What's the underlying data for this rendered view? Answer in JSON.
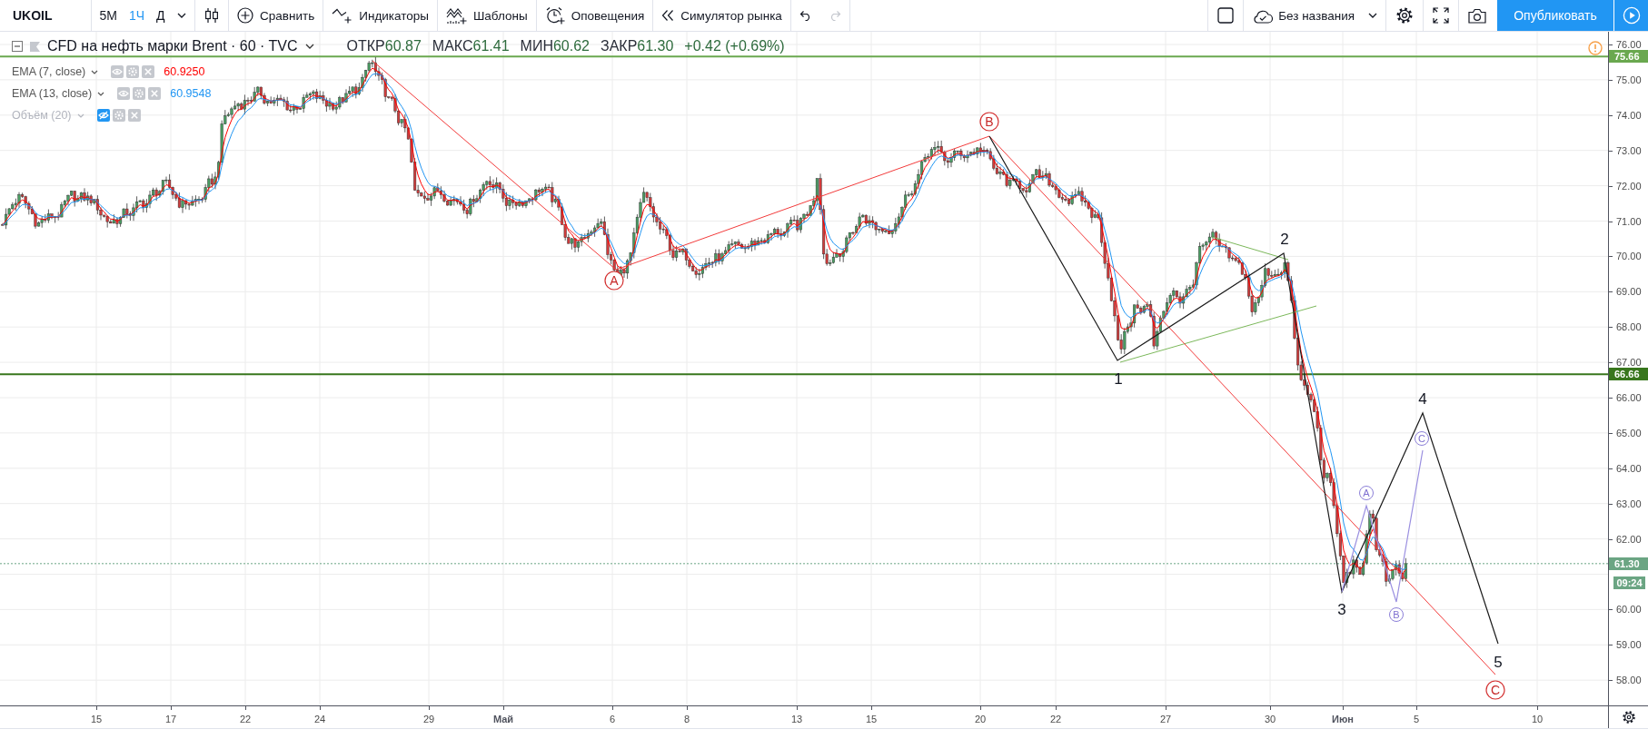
{
  "toolbar": {
    "symbol": "UKOIL",
    "intervals": [
      {
        "label": "5М",
        "selected": false
      },
      {
        "label": "1Ч",
        "selected": true
      },
      {
        "label": "Д",
        "selected": false
      }
    ],
    "buttons": [
      {
        "kind": "compare",
        "label": "Сравнить"
      },
      {
        "kind": "indicators",
        "label": "Индикаторы"
      },
      {
        "kind": "templates",
        "label": "Шаблоны"
      },
      {
        "kind": "alerts",
        "label": "Оповещения"
      },
      {
        "kind": "replay",
        "label": "Симулятор рынка"
      }
    ],
    "history": [
      {
        "kind": "undo",
        "disabled": false
      },
      {
        "kind": "redo",
        "disabled": true
      }
    ],
    "layout_name": "Без названия",
    "publish_label": "Опубликовать"
  },
  "legend": {
    "title": "CFD на нефть марки Brent · 60 · TVC",
    "ohlc": [
      {
        "label": "ОТКР",
        "value": "60.87"
      },
      {
        "label": "МАКС",
        "value": "61.41"
      },
      {
        "label": "МИН",
        "value": "60.62"
      },
      {
        "label": "ЗАКР",
        "value": "61.30"
      }
    ],
    "change": "+0.42 (+0.69%)",
    "indicators": [
      {
        "kind": "ema",
        "name": "EMA (7, close)",
        "value": "60.9250",
        "color": "#ff0000",
        "hidden": false
      },
      {
        "kind": "ema",
        "name": "EMA (13, close)",
        "value": "60.9548",
        "color": "#2196f3",
        "hidden": false
      },
      {
        "kind": "volume",
        "name": "Объём (20)",
        "hidden": true
      }
    ]
  },
  "chart_drawings": {
    "abc_labels": [
      "A",
      "B",
      "C"
    ],
    "impulse_labels": [
      "1",
      "2",
      "3",
      "4",
      "5"
    ],
    "subwave_labels": [
      "A",
      "B",
      "C"
    ]
  },
  "price_axis": {
    "ticks": [
      "76.00",
      "75.00",
      "74.00",
      "73.00",
      "72.00",
      "71.00",
      "70.00",
      "69.00",
      "68.00",
      "67.00",
      "66.00",
      "65.00",
      "64.00",
      "63.00",
      "62.00",
      "60.00",
      "59.00",
      "58.00"
    ],
    "markers": [
      {
        "kind": "level",
        "value": "75.66",
        "color": "#6aa84f"
      },
      {
        "kind": "level",
        "value": "66.66",
        "color": "#38761d"
      },
      {
        "kind": "last_price",
        "value": "61.30",
        "color": "#6ba583",
        "countdown": "09:24"
      }
    ]
  },
  "time_axis": {
    "labels": [
      {
        "text": "15",
        "kind": "day"
      },
      {
        "text": "17",
        "kind": "day"
      },
      {
        "text": "22",
        "kind": "day"
      },
      {
        "text": "24",
        "kind": "day"
      },
      {
        "text": "29",
        "kind": "day"
      },
      {
        "text": "Май",
        "kind": "month"
      },
      {
        "text": "6",
        "kind": "day"
      },
      {
        "text": "8",
        "kind": "day"
      },
      {
        "text": "13",
        "kind": "day"
      },
      {
        "text": "15",
        "kind": "day"
      },
      {
        "text": "20",
        "kind": "day"
      },
      {
        "text": "22",
        "kind": "day"
      },
      {
        "text": "27",
        "kind": "day"
      },
      {
        "text": "30",
        "kind": "day"
      },
      {
        "text": "Июн",
        "kind": "month"
      },
      {
        "text": "5",
        "kind": "day"
      },
      {
        "text": "10",
        "kind": "day"
      }
    ]
  }
}
